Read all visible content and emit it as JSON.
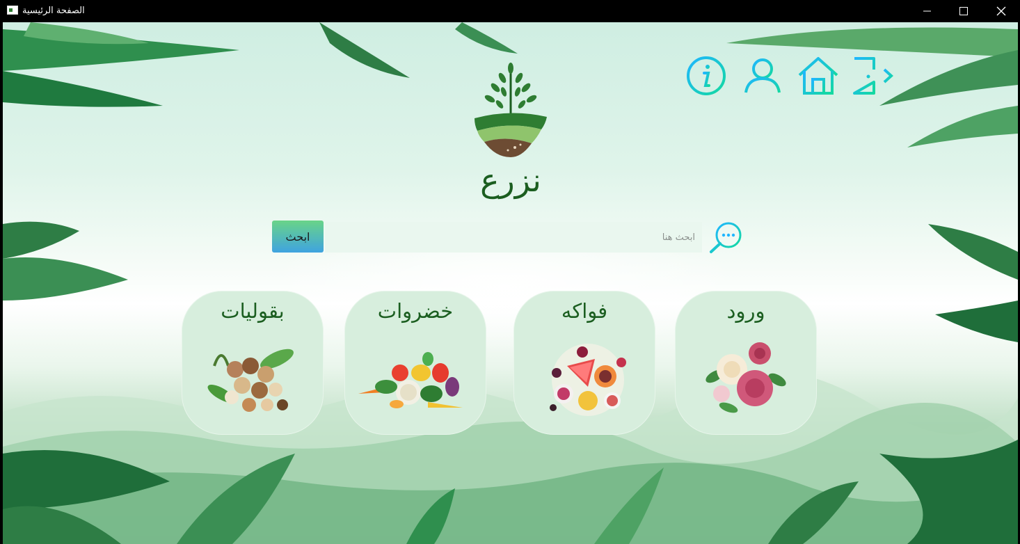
{
  "window": {
    "title": "الصفحة الرئيسية",
    "controls": [
      "minimize",
      "maximize",
      "close"
    ]
  },
  "brand": {
    "name": "نزرع",
    "logo_icon": "tree-field-logo-icon"
  },
  "nav_icons": [
    {
      "name": "info-icon"
    },
    {
      "name": "user-icon"
    },
    {
      "name": "home-icon"
    },
    {
      "name": "logout-icon"
    }
  ],
  "search": {
    "placeholder": "ابحث هنا",
    "button_label": "ابحث",
    "icon": "search-chat-icon"
  },
  "categories": [
    {
      "label": "ورود",
      "icon": "roses-bouquet-icon"
    },
    {
      "label": "فواكه",
      "icon": "fruits-icon"
    },
    {
      "label": "خضروات",
      "icon": "vegetables-icon"
    },
    {
      "label": "بقوليات",
      "icon": "legumes-nuts-icon"
    }
  ],
  "colors": {
    "icon_gradient_start": "#1fb6ff",
    "icon_gradient_end": "#14d9a0",
    "brand_green": "#1b5e20",
    "card_bg": "#d7eedd"
  }
}
